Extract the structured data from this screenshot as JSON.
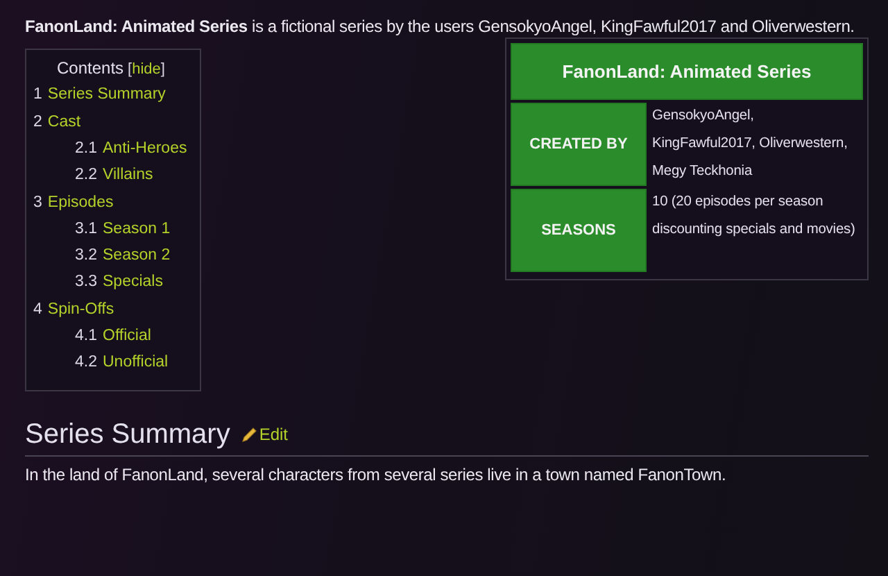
{
  "intro": "**FanonLand: Animated Series** is a fictional series by the users GensokyoAngel, KingFawful2017 and Oliverwestern.",
  "toc": {
    "title": "Contents",
    "toggle_open": "[",
    "toggle": "hide",
    "toggle_close": "]",
    "items": [
      {
        "number": "1",
        "label": "Series Summary"
      },
      {
        "number": "2",
        "label": "Cast",
        "children": [
          {
            "number": "2.1",
            "label": "Anti-Heroes"
          },
          {
            "number": "2.2",
            "label": "Villains"
          }
        ]
      },
      {
        "number": "3",
        "label": "Episodes",
        "children": [
          {
            "number": "3.1",
            "label": "Season 1"
          },
          {
            "number": "3.2",
            "label": "Season 2"
          },
          {
            "number": "3.3",
            "label": "Specials"
          }
        ]
      },
      {
        "number": "4",
        "label": "Spin-Offs",
        "children": [
          {
            "number": "4.1",
            "label": "Official"
          },
          {
            "number": "4.2",
            "label": "Unofficial"
          }
        ]
      }
    ]
  },
  "infobox": {
    "title": "FanonLand: Animated Series",
    "rows": [
      {
        "label": "CREATED BY",
        "value": "GensokyoAngel, KingFawful2017, Oliverwestern, Megy Teckhonia"
      },
      {
        "label": "SEASONS",
        "value": "10 (20 episodes per season discounting specials and movies)"
      }
    ]
  },
  "section": {
    "heading": "Series Summary",
    "edit": "Edit",
    "text": "In the land of FanonLand, several characters from several series live in a town named FanonTown."
  }
}
